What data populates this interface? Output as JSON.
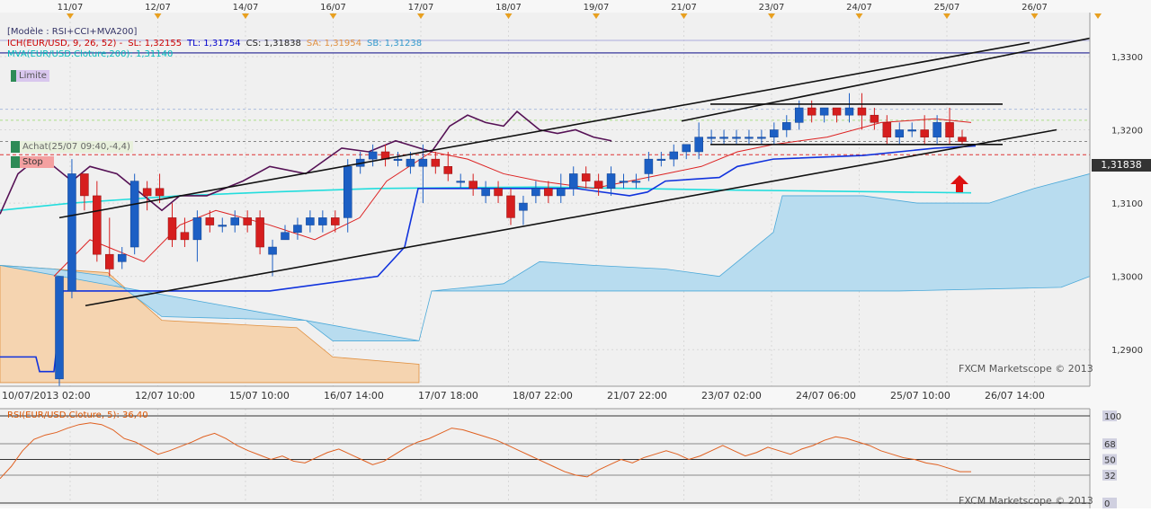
{
  "chart_data": [
    {
      "type": "candlestick",
      "panel": "price",
      "top_axis_labels": [
        "11/07",
        "12/07",
        "14/07",
        "16/07",
        "17/07",
        "18/07",
        "19/07",
        "21/07",
        "23/07",
        "24/07",
        "25/07",
        "26/07"
      ],
      "bottom_axis_labels": [
        "10/07/2013 02:00",
        "12/07 10:00",
        "15/07 10:00",
        "16/07 14:00",
        "17/07 18:00",
        "18/07 22:00",
        "21/07 22:00",
        "23/07 02:00",
        "24/07 06:00",
        "25/07 10:00",
        "26/07 14:00"
      ],
      "y_ticks": [
        "1,3300",
        "1,3200",
        "1,3100",
        "1,3000",
        "1,2900"
      ],
      "ylim": [
        1.285,
        1.336
      ],
      "current_price_label": "1,31838",
      "indicators": {
        "model": "[Modèle : RSI+CCI+MVA200]",
        "ich_prefix": "ICH(EUR/USD, 9, 26, 52) -",
        "sl": "SL: 1,32155",
        "tl": "TL: 1,31754",
        "cs": "CS: 1,31838",
        "sa": "SA: 1,31954",
        "sb": "SB: 1,31238",
        "mva": "MVA(EUR/USD.Cloture,200): 1,31140"
      },
      "annotations": {
        "limit": "Limite",
        "achat": "Achat(25/07 09:40,-4,4)",
        "stop": "Stop",
        "watermark": "FXCM Marketscope © 2013"
      },
      "candles": [
        [
          1.286,
          1.3,
          1.285,
          1.286
        ],
        [
          1.298,
          1.314,
          1.316,
          1.297
        ],
        [
          1.314,
          1.311,
          1.314,
          1.309
        ],
        [
          1.311,
          1.303,
          1.313,
          1.302
        ],
        [
          1.303,
          1.301,
          1.308,
          1.3
        ],
        [
          1.302,
          1.303,
          1.304,
          1.301
        ],
        [
          1.304,
          1.313,
          1.314,
          1.303
        ],
        [
          1.312,
          1.311,
          1.313,
          1.309
        ],
        [
          1.312,
          1.311,
          1.314,
          1.31
        ],
        [
          1.308,
          1.305,
          1.31,
          1.304
        ],
        [
          1.306,
          1.305,
          1.308,
          1.304
        ],
        [
          1.305,
          1.308,
          1.309,
          1.302
        ],
        [
          1.308,
          1.307,
          1.309,
          1.306
        ],
        [
          1.307,
          1.307,
          1.308,
          1.306
        ],
        [
          1.307,
          1.308,
          1.309,
          1.306
        ],
        [
          1.308,
          1.307,
          1.309,
          1.306
        ],
        [
          1.308,
          1.304,
          1.309,
          1.303
        ],
        [
          1.303,
          1.304,
          1.305,
          1.3
        ],
        [
          1.305,
          1.306,
          1.307,
          1.305
        ],
        [
          1.306,
          1.307,
          1.308,
          1.305
        ],
        [
          1.307,
          1.308,
          1.309,
          1.306
        ],
        [
          1.307,
          1.308,
          1.309,
          1.306
        ],
        [
          1.308,
          1.307,
          1.309,
          1.306
        ],
        [
          1.308,
          1.315,
          1.316,
          1.306
        ],
        [
          1.315,
          1.316,
          1.317,
          1.314
        ],
        [
          1.316,
          1.317,
          1.318,
          1.315
        ],
        [
          1.317,
          1.316,
          1.318,
          1.315
        ],
        [
          1.316,
          1.316,
          1.317,
          1.315
        ],
        [
          1.315,
          1.316,
          1.317,
          1.314
        ],
        [
          1.315,
          1.316,
          1.318,
          1.31
        ],
        [
          1.316,
          1.315,
          1.317,
          1.314
        ],
        [
          1.315,
          1.314,
          1.317,
          1.313
        ],
        [
          1.313,
          1.313,
          1.314,
          1.312
        ],
        [
          1.313,
          1.312,
          1.314,
          1.311
        ],
        [
          1.311,
          1.312,
          1.313,
          1.31
        ],
        [
          1.312,
          1.311,
          1.313,
          1.31
        ],
        [
          1.311,
          1.308,
          1.312,
          1.307
        ],
        [
          1.309,
          1.31,
          1.311,
          1.307
        ],
        [
          1.311,
          1.312,
          1.313,
          1.31
        ],
        [
          1.312,
          1.311,
          1.313,
          1.31
        ],
        [
          1.311,
          1.312,
          1.314,
          1.31
        ],
        [
          1.312,
          1.314,
          1.315,
          1.311
        ],
        [
          1.314,
          1.313,
          1.315,
          1.312
        ],
        [
          1.313,
          1.312,
          1.314,
          1.311
        ],
        [
          1.312,
          1.314,
          1.315,
          1.311
        ],
        [
          1.313,
          1.313,
          1.314,
          1.312
        ],
        [
          1.313,
          1.313,
          1.314,
          1.312
        ],
        [
          1.314,
          1.316,
          1.317,
          1.313
        ],
        [
          1.316,
          1.316,
          1.317,
          1.315
        ],
        [
          1.316,
          1.317,
          1.318,
          1.315
        ],
        [
          1.317,
          1.318,
          1.318,
          1.316
        ],
        [
          1.317,
          1.319,
          1.321,
          1.316
        ],
        [
          1.319,
          1.319,
          1.32,
          1.318
        ],
        [
          1.319,
          1.319,
          1.32,
          1.318
        ],
        [
          1.319,
          1.319,
          1.32,
          1.318
        ],
        [
          1.319,
          1.319,
          1.32,
          1.318
        ],
        [
          1.319,
          1.319,
          1.32,
          1.318
        ],
        [
          1.319,
          1.32,
          1.321,
          1.318
        ],
        [
          1.32,
          1.321,
          1.322,
          1.319
        ],
        [
          1.321,
          1.323,
          1.324,
          1.32
        ],
        [
          1.323,
          1.322,
          1.324,
          1.321
        ],
        [
          1.322,
          1.323,
          1.323,
          1.321
        ],
        [
          1.323,
          1.322,
          1.323,
          1.321
        ],
        [
          1.322,
          1.323,
          1.325,
          1.321
        ],
        [
          1.323,
          1.322,
          1.325,
          1.32
        ],
        [
          1.322,
          1.321,
          1.323,
          1.32
        ],
        [
          1.321,
          1.319,
          1.322,
          1.318
        ],
        [
          1.319,
          1.32,
          1.321,
          1.318
        ],
        [
          1.32,
          1.32,
          1.321,
          1.319
        ],
        [
          1.32,
          1.319,
          1.322,
          1.318
        ],
        [
          1.319,
          1.321,
          1.322,
          1.318
        ],
        [
          1.321,
          1.319,
          1.323,
          1.318
        ],
        [
          1.319,
          1.3184,
          1.32,
          1.318
        ]
      ],
      "rsi_main": [
        [
          0,
          1.319
        ],
        [
          2,
          1.317
        ],
        [
          4,
          1.316
        ],
        [
          6,
          1.313
        ],
        [
          8,
          1.312
        ],
        [
          10,
          1.312
        ],
        [
          12,
          1.311
        ],
        [
          14,
          1.31
        ],
        [
          16,
          1.311
        ],
        [
          18,
          1.312
        ],
        [
          20,
          1.313
        ],
        [
          22,
          1.315
        ],
        [
          24,
          1.318
        ],
        [
          26,
          1.317
        ],
        [
          28,
          1.318
        ],
        [
          30,
          1.319
        ],
        [
          32,
          1.32
        ],
        [
          34,
          1.323
        ],
        [
          36,
          1.322
        ],
        [
          38,
          1.322
        ],
        [
          40,
          1.321
        ],
        [
          42,
          1.319
        ],
        [
          44,
          1.32
        ]
      ],
      "legend_colors": {
        "ich": "#cc0000",
        "tl": "#0000cc",
        "cs": "#222222",
        "sa": "#e09040",
        "sb": "#3399cc",
        "mva": "#00cccc",
        "model": "#333366"
      }
    },
    {
      "type": "line",
      "panel": "rsi",
      "legend": "RSI(EUR/USD.Cloture, 5): 36,40",
      "y_ticks": [
        "100",
        "68",
        "50",
        "32",
        "0"
      ],
      "ylim": [
        0,
        100
      ],
      "watermark": "FXCM Marketscope © 2013",
      "values": [
        28,
        42,
        60,
        73,
        78,
        81,
        86,
        90,
        92,
        90,
        84,
        74,
        70,
        63,
        56,
        60,
        65,
        70,
        76,
        80,
        74,
        66,
        60,
        55,
        50,
        54,
        48,
        46,
        52,
        58,
        62,
        56,
        50,
        44,
        48,
        56,
        64,
        70,
        74,
        80,
        86,
        84,
        80,
        76,
        72,
        66,
        60,
        54,
        48,
        42,
        36,
        32,
        30,
        38,
        44,
        50,
        46,
        52,
        56,
        60,
        56,
        50,
        54,
        60,
        66,
        60,
        54,
        58,
        64,
        60,
        56,
        62,
        66,
        72,
        76,
        74,
        70,
        66,
        60,
        56,
        52,
        50,
        46,
        44,
        40,
        36,
        36
      ]
    }
  ]
}
